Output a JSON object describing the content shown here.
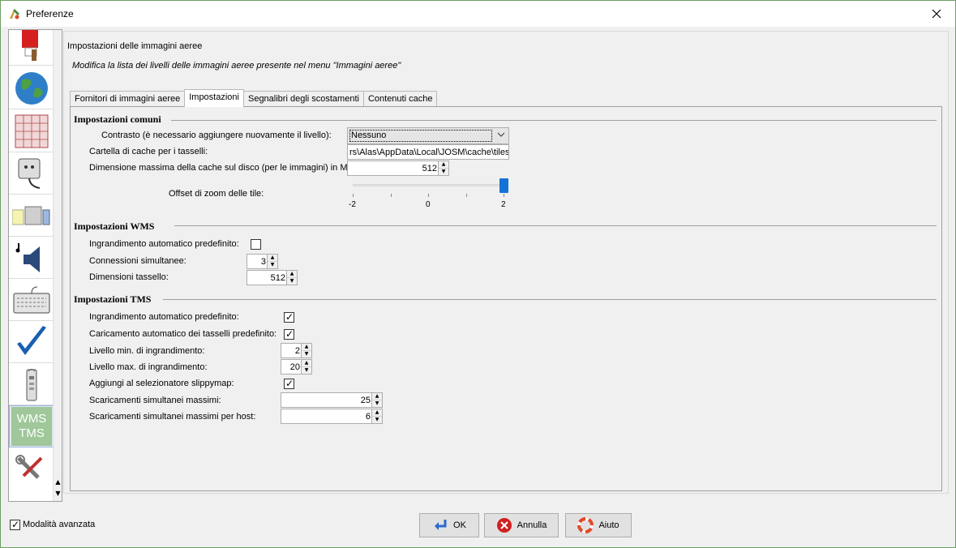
{
  "window": {
    "title": "Preferenze"
  },
  "sidebar": {
    "items": [
      {
        "icon": "paint-bucket-icon"
      },
      {
        "icon": "globe-icon"
      },
      {
        "icon": "map-grid-icon"
      },
      {
        "icon": "plug-icon"
      },
      {
        "icon": "folder-icon"
      },
      {
        "icon": "speaker-icon"
      },
      {
        "icon": "keyboard-icon"
      },
      {
        "icon": "checkmark-icon"
      },
      {
        "icon": "remote-control-icon"
      },
      {
        "icon": "wms-tms-icon",
        "label_line1": "WMS",
        "label_line2": "TMS",
        "selected": true
      },
      {
        "icon": "tools-icon"
      }
    ]
  },
  "main": {
    "heading": "Impostazioni delle immagini aeree",
    "subheading": "Modifica la lista dei livelli delle immagini aeree presente nel menu \"Immagini aeree\"",
    "tabs": [
      {
        "label": "Fornitori di immagini aeree",
        "active": false
      },
      {
        "label": "Impostazioni",
        "active": true
      },
      {
        "label": "Segnalibri degli scostamenti",
        "active": false
      },
      {
        "label": "Contenuti cache",
        "active": false
      }
    ]
  },
  "common": {
    "title": "Impostazioni comuni",
    "contrast_label": "Contrasto (è necessario aggiungere nuovamente il livello):",
    "contrast_value": "Nessuno",
    "cache_dir_label": "Cartella di cache per i tasselli:",
    "cache_dir_value": "rs\\Alas\\AppData\\Local\\JOSM\\cache\\tiles",
    "cache_size_label": "Dimensione massima della cache sul disco (per le immagini) in MB:",
    "cache_size_value": "512",
    "zoom_offset_label": "Offset di zoom delle tile:",
    "zoom_offset": {
      "min": -2,
      "max": 2,
      "value": 2,
      "tick_labels": [
        "-2",
        "0",
        "2"
      ]
    }
  },
  "wms": {
    "title": "Impostazioni WMS",
    "autozoom_label": "Ingrandimento automatico predefinito:",
    "autozoom_checked": false,
    "connections_label": "Connessioni simultanee:",
    "connections_value": "3",
    "tile_size_label": "Dimensioni tassello:",
    "tile_size_value": "512"
  },
  "tms": {
    "title": "Impostazioni TMS",
    "autozoom_label": "Ingrandimento automatico predefinito:",
    "autozoom_checked": true,
    "autoload_label": "Caricamento automatico dei tasselli predefinito:",
    "autoload_checked": true,
    "min_zoom_label": "Livello min. di ingrandimento:",
    "min_zoom_value": "2",
    "max_zoom_label": "Livello max. di ingrandimento:",
    "max_zoom_value": "20",
    "slippymap_label": "Aggiungi al selezionatore slippymap:",
    "slippymap_checked": true,
    "max_downloads_label": "Scaricamenti simultanei massimi:",
    "max_downloads_value": "25",
    "max_downloads_host_label": "Scaricamenti simultanei massimi per host:",
    "max_downloads_host_value": "6"
  },
  "footer": {
    "advanced_label": "Modalità avanzata",
    "advanced_checked": true,
    "ok_label": "OK",
    "cancel_label": "Annulla",
    "help_label": "Aiuto"
  }
}
